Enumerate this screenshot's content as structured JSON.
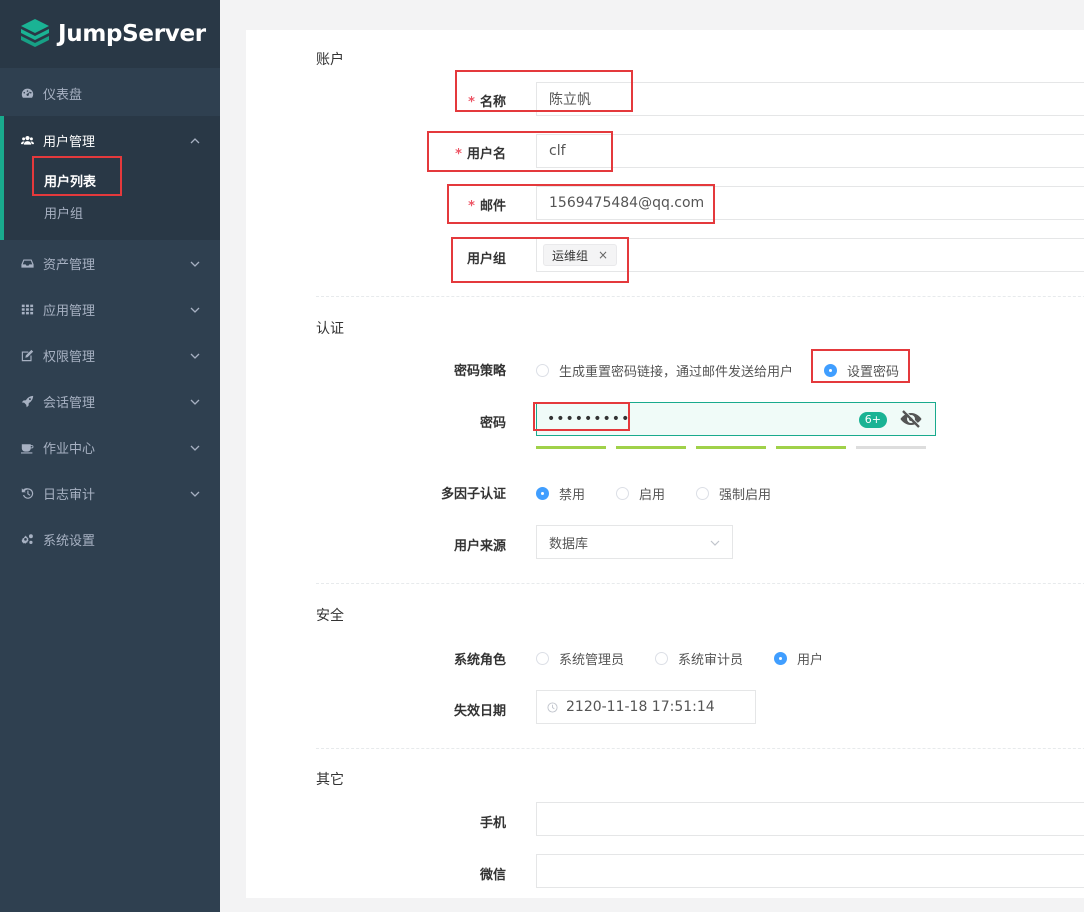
{
  "brand": {
    "name": "JumpServer"
  },
  "sidebar": {
    "items": [
      {
        "label": "仪表盘",
        "icon": "dashboard-icon"
      },
      {
        "label": "用户管理",
        "icon": "users-icon",
        "open": true,
        "children": [
          {
            "label": "用户列表",
            "active": true
          },
          {
            "label": "用户组"
          }
        ]
      },
      {
        "label": "资产管理",
        "icon": "inbox-icon"
      },
      {
        "label": "应用管理",
        "icon": "grid-icon"
      },
      {
        "label": "权限管理",
        "icon": "edit-icon"
      },
      {
        "label": "会话管理",
        "icon": "rocket-icon"
      },
      {
        "label": "作业中心",
        "icon": "coffee-icon"
      },
      {
        "label": "日志审计",
        "icon": "history-icon"
      },
      {
        "label": "系统设置",
        "icon": "gears-icon"
      }
    ]
  },
  "form": {
    "account": {
      "title": "账户",
      "name": {
        "label": "名称",
        "value": "陈立帆"
      },
      "username": {
        "label": "用户名",
        "value": "clf"
      },
      "email": {
        "label": "邮件",
        "value": "1569475484@qq.com"
      },
      "groups": {
        "label": "用户组",
        "tags": [
          "运维组"
        ]
      }
    },
    "auth": {
      "title": "认证",
      "policy": {
        "label": "密码策略",
        "options": [
          "生成重置密码链接，通过邮件发送给用户",
          "设置密码"
        ],
        "selected": 1
      },
      "password": {
        "label": "密码",
        "value": "•••••••••",
        "badge": "6+",
        "strength": 4
      },
      "mfa": {
        "label": "多因子认证",
        "options": [
          "禁用",
          "启用",
          "强制启用"
        ],
        "selected": 0
      },
      "source": {
        "label": "用户来源",
        "value": "数据库"
      }
    },
    "security": {
      "title": "安全",
      "role": {
        "label": "系统角色",
        "options": [
          "系统管理员",
          "系统审计员",
          "用户"
        ],
        "selected": 2
      },
      "expire": {
        "label": "失效日期",
        "value": "2120-11-18 17:51:14"
      }
    },
    "other": {
      "title": "其它",
      "phone": {
        "label": "手机",
        "value": ""
      },
      "wechat": {
        "label": "微信",
        "value": ""
      }
    }
  },
  "colors": {
    "sidebar": "#2f4050",
    "accent": "#19aa8d",
    "radio": "#409eff",
    "highlight": "#e4393c",
    "required": "#ed5565"
  }
}
